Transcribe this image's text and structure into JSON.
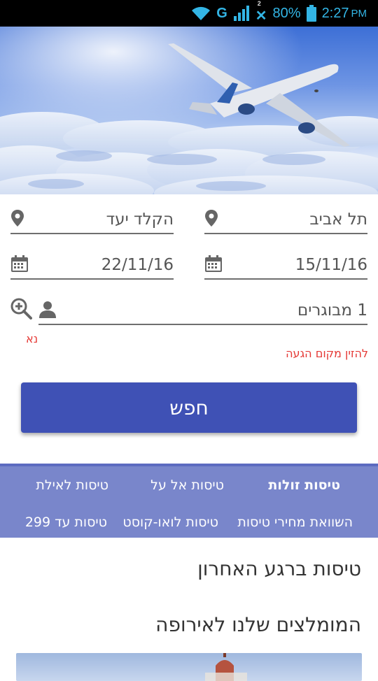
{
  "status": {
    "network": "G",
    "notif_count": "2",
    "battery": "80%",
    "time": "2:27",
    "ampm": "PM"
  },
  "form": {
    "origin": "תל אביב",
    "destination_placeholder": "הקלד יעד",
    "depart_date": "15/11/16",
    "return_date": "22/11/16",
    "passengers": "1 מבוגרים",
    "left_error": "נא",
    "right_error": "להזין מקום הגעה",
    "search_label": "חפש"
  },
  "links": {
    "row1": [
      "טיסות זולות",
      "טיסות אל על",
      "טיסות לאילת"
    ],
    "row2": [
      "השוואת מחירי טיסות",
      "טיסות לואו-קוסט",
      "טיסות עד 299"
    ]
  },
  "sections": {
    "last_minute": "טיסות ברגע האחרון",
    "europe": "המומלצים שלנו לאירופה"
  },
  "colors": {
    "primary": "#3f51b5",
    "links_bg": "#7986cb",
    "error": "#e53935",
    "status_icons": "#33b5e5"
  }
}
